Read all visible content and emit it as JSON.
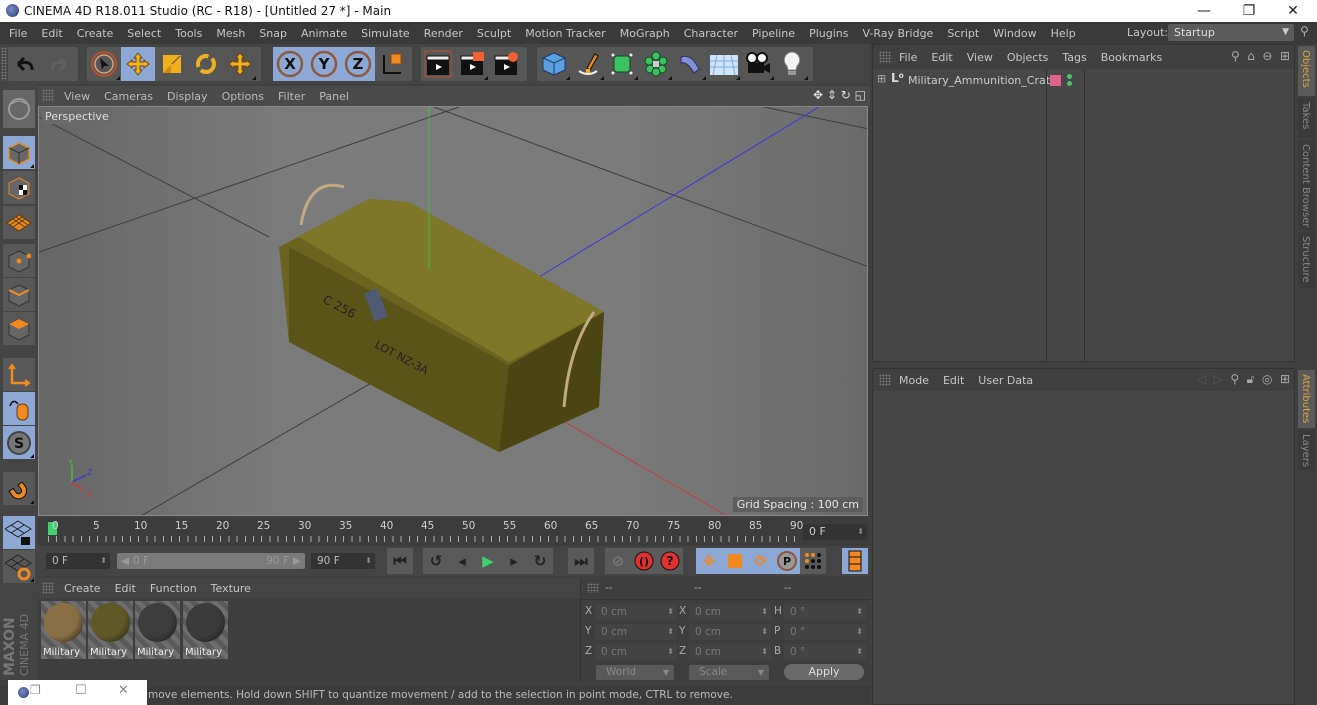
{
  "window": {
    "title": "CINEMA 4D R18.011 Studio (RC - R18) - [Untitled 27 *] - Main",
    "controls": {
      "minimize": "—",
      "restore": "❐",
      "close": "✕"
    }
  },
  "menubar": {
    "items": [
      "File",
      "Edit",
      "Create",
      "Select",
      "Tools",
      "Mesh",
      "Snap",
      "Animate",
      "Simulate",
      "Render",
      "Sculpt",
      "Motion Tracker",
      "MoGraph",
      "Character",
      "Pipeline",
      "Plugins",
      "V-Ray Bridge",
      "Script",
      "Window",
      "Help"
    ],
    "layout_label": "Layout:",
    "layout_value": "Startup"
  },
  "toolbar": {
    "icons": [
      "undo-icon",
      "redo-icon",
      "live-selection-icon",
      "move-icon",
      "scale-icon",
      "rotate-icon",
      "recent-tool-icon",
      "x-axis-lock-icon",
      "y-axis-lock-icon",
      "z-axis-lock-icon",
      "coordinate-system-icon",
      "render-view-icon",
      "render-to-picture-viewer-icon",
      "render-settings-icon",
      "cube-primitive-icon",
      "pen-spline-icon",
      "subdivision-surface-icon",
      "cloner-icon",
      "deformer-icon",
      "floor-icon",
      "camera-icon",
      "light-icon"
    ]
  },
  "left_toolbar": {
    "icons": [
      "make-editable-icon",
      "model-mode-icon",
      "texture-mode-icon",
      "workplane-mode-icon",
      "points-mode-icon",
      "edges-mode-icon",
      "polygons-mode-icon",
      "axis-mode-icon",
      "tweak-mode-icon",
      "solo-mode-icon",
      "snap-magnet-icon",
      "lock-workplane-icon",
      "planar-workplane-icon"
    ]
  },
  "viewport": {
    "menu": [
      "View",
      "Cameras",
      "Display",
      "Options",
      "Filter",
      "Panel"
    ],
    "camera_label": "Perspective",
    "grid_spacing": "Grid Spacing : 100 cm",
    "object_texts": [
      "C 256",
      "LOT NZ-3A"
    ]
  },
  "timeline": {
    "ticks": [
      "0",
      "5",
      "10",
      "15",
      "20",
      "25",
      "30",
      "35",
      "40",
      "45",
      "50",
      "55",
      "60",
      "65",
      "70",
      "75",
      "80",
      "85",
      "90"
    ],
    "current_frame": "0 F"
  },
  "transport": {
    "start_frame": "0 F",
    "range_start": "0 F",
    "range_end": "90 F",
    "end_frame": "90 F"
  },
  "material_manager": {
    "menu": [
      "Create",
      "Edit",
      "Function",
      "Texture"
    ],
    "materials": [
      {
        "label": "Military",
        "color": "#8a6e45"
      },
      {
        "label": "Military",
        "color": "#5e5a28"
      },
      {
        "label": "Military",
        "color": "#3d3d3d"
      },
      {
        "label": "Military",
        "color": "#3a3a3a"
      }
    ]
  },
  "coordinates": {
    "headers": [
      "--",
      "--",
      "--"
    ],
    "position": {
      "x": "0 cm",
      "y": "0 cm",
      "z": "0 cm"
    },
    "size": {
      "x": "0 cm",
      "y": "0 cm",
      "z": "0 cm"
    },
    "rotation": {
      "h": "0 °",
      "p": "0 °",
      "b": "0 °"
    },
    "labels": {
      "x": "X",
      "y": "Y",
      "z": "Z",
      "h": "H",
      "p": "P",
      "b": "B"
    },
    "mode": "World",
    "size_mode": "Scale",
    "apply_label": "Apply"
  },
  "status": {
    "text": "move elements. Hold down SHIFT to quantize movement / add to the selection in point mode, CTRL to remove."
  },
  "branding": {
    "maxon": "MAXON",
    "cinema": "CINEMA 4D"
  },
  "object_manager": {
    "menu": [
      "File",
      "Edit",
      "View",
      "Objects",
      "Tags",
      "Bookmarks"
    ],
    "objects": [
      {
        "name": "Military_Ammunition_Crate",
        "layer_color": "#e0608e",
        "visibility_color": "#4fc56a"
      }
    ]
  },
  "attribute_manager": {
    "menu": [
      "Mode",
      "Edit",
      "User Data"
    ]
  },
  "side_tabs": {
    "top": [
      "Objects",
      "Takes",
      "Content Browser",
      "Structure"
    ],
    "bottom": [
      "Attributes",
      "Layers"
    ]
  },
  "colors": {
    "active_tab": "#d9a441",
    "selected_button": "#8ea8d6",
    "axis_x": "#c04040",
    "axis_y": "#3fbf3f",
    "axis_z": "#3a3ad0"
  }
}
